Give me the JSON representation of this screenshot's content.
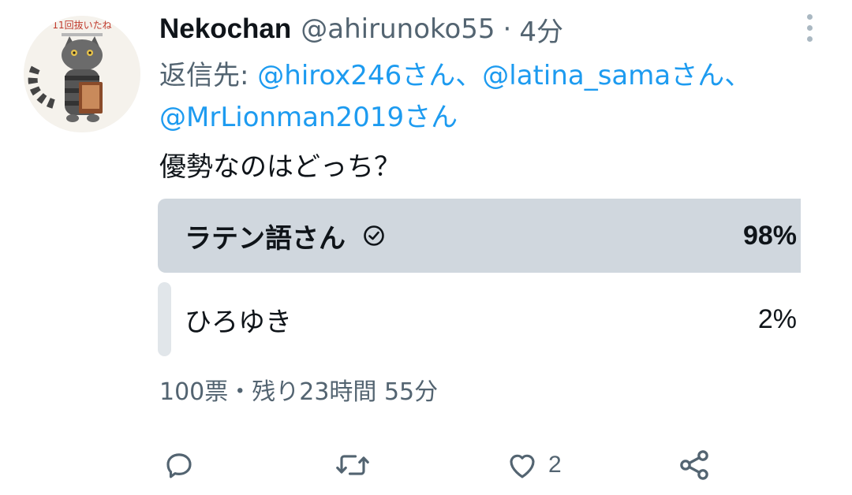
{
  "tweet": {
    "author_name": "Nekochan",
    "author_handle": "@ahirunoko55",
    "separator": "·",
    "time": "4分",
    "reply_prefix": "返信先: ",
    "reply_mentions": [
      "@hirox246さん",
      "@latina_samaさん",
      "@MrLionman2019さん"
    ],
    "reply_separator": "、",
    "text": "優勢なのはどっち？",
    "avatar_caption": "11回抜いたね"
  },
  "poll": {
    "options": [
      {
        "label": "ラテン語さん",
        "percent_label": "98%",
        "percent": 98,
        "winner": true
      },
      {
        "label": "ひろゆき",
        "percent_label": "2%",
        "percent": 2,
        "winner": false
      }
    ],
    "meta": "100票・残り23時間 55分"
  },
  "actions": {
    "reply_icon": "reply-icon",
    "retweet_icon": "retweet-icon",
    "like_icon": "like-icon",
    "like_count": "2",
    "share_icon": "share-icon"
  },
  "colors": {
    "accent": "#1d9bf0",
    "secondary_text": "#536471",
    "poll_winner_bar": "#d0d7de",
    "poll_loser_bar": "#e1e6ea"
  }
}
